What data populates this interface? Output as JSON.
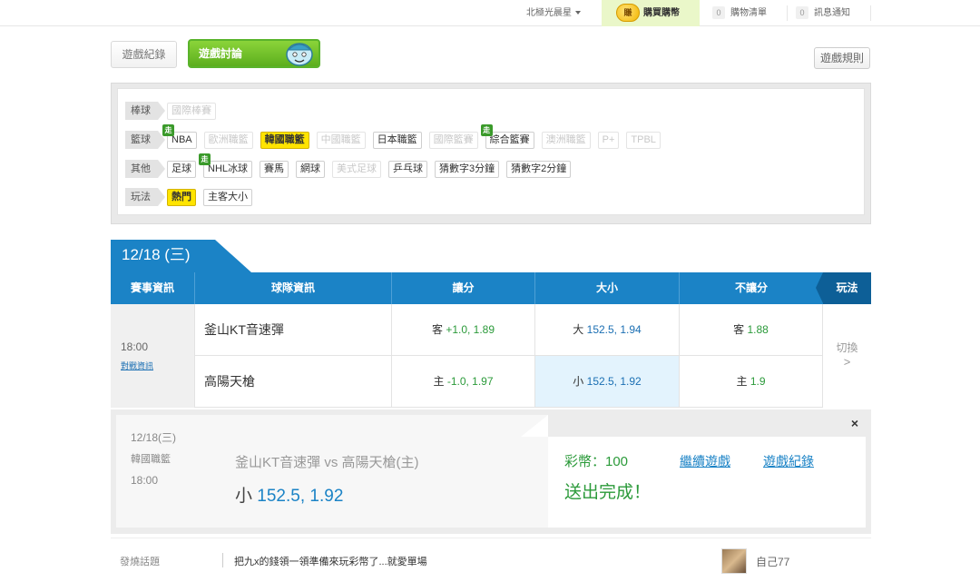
{
  "topbar": {
    "user": "北極光晨星",
    "buy_coin_icon": "賺",
    "buy_label": "購買購幣",
    "cart_count": "0",
    "cart_label": "購物清單",
    "msg_count": "0",
    "msg_label": "訊息通知"
  },
  "tabs": {
    "record": "遊戲紀錄",
    "discuss": "遊戲討論",
    "rules": "遊戲規則"
  },
  "filters": {
    "baseball": {
      "label": "棒球",
      "items": [
        "國際棒賽"
      ]
    },
    "basketball": {
      "label": "籃球",
      "items": [
        "NBA",
        "歐洲職籃",
        "韓國職籃",
        "中國職籃",
        "日本職籃",
        "國際籃賽",
        "綜合籃賽",
        "澳洲職籃",
        "P+",
        "TPBL"
      ]
    },
    "other": {
      "label": "其他",
      "items": [
        "足球",
        "NHL冰球",
        "賽馬",
        "網球",
        "美式足球",
        "乒乓球",
        "猜數字3分鐘",
        "猜數字2分鐘"
      ]
    },
    "play": {
      "label": "玩法",
      "items": [
        "熱門",
        "主客大小"
      ]
    },
    "walk_badge": "走"
  },
  "date_tab": "12/18 (三)",
  "table": {
    "headers": [
      "賽事資訊",
      "球隊資訊",
      "讓分",
      "大小",
      "不讓分"
    ],
    "play_tab": "玩法",
    "time": "18:00",
    "vs_link": "對戰資訊",
    "away": {
      "team": "釜山KT音速彈",
      "spread_prefix": "客",
      "spread": "+1.0, 1.89",
      "total_prefix": "大",
      "total": "152.5, 1.94",
      "ml_prefix": "客",
      "ml": "1.88"
    },
    "home": {
      "team": "高陽天槍",
      "spread_prefix": "主",
      "spread": "-1.0, 1.97",
      "total_prefix": "小",
      "total": "152.5, 1.92",
      "ml_prefix": "主",
      "ml": "1.9"
    },
    "switch_label": "切換",
    "switch_arrow": ">"
  },
  "confirm": {
    "date": "12/18(三)",
    "league": "韓國職籃",
    "time": "18:00",
    "match": "釜山KT音速彈 vs 高陽天槍(主)",
    "bet_prefix": "小",
    "bet_value": "152.5, 1.92",
    "coins": "彩幣：100",
    "done": "送出完成！",
    "continue_link": "繼續遊戲",
    "record_link": "遊戲紀錄",
    "close": "×"
  },
  "hot": {
    "label": "發燒話題",
    "text": "把九x的錢領一領準備來玩彩幣了...就愛單場",
    "user": "自己77"
  }
}
